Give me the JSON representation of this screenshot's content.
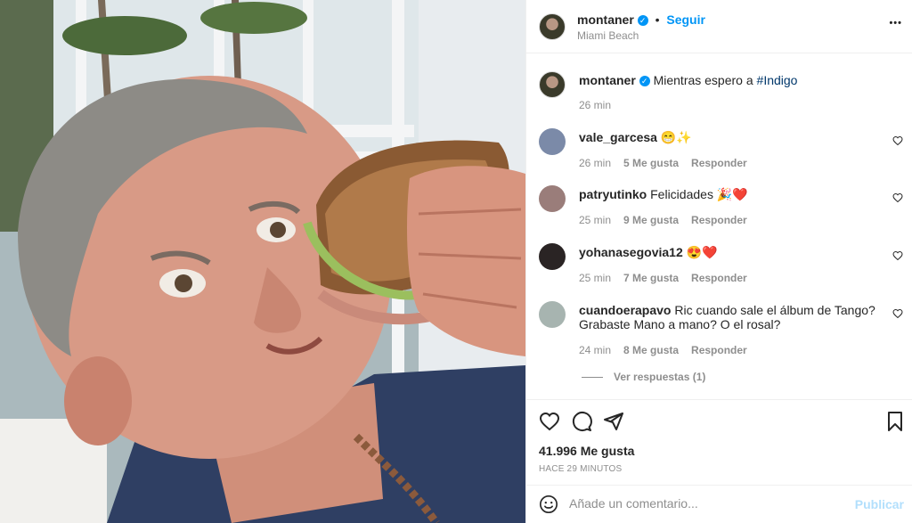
{
  "post": {
    "username": "montaner",
    "verified_icon": "✓",
    "separator": "•",
    "follow_label": "Seguir",
    "location": "Miami Beach",
    "more_icon": "•••"
  },
  "caption": {
    "username": "montaner",
    "text_prefix": "Mientras espero a ",
    "hashtag": "#Indigo",
    "time": "26 min"
  },
  "comments": [
    {
      "username": "vale_garcesa",
      "text": "😁✨",
      "time": "26 min",
      "likes": "5 Me gusta",
      "reply": "Responder",
      "avatar_color": "#7b8aa8"
    },
    {
      "username": "patryutinko",
      "text": "Felicidades 🎉❤️",
      "time": "25 min",
      "likes": "9 Me gusta",
      "reply": "Responder",
      "avatar_color": "#9a7d7a"
    },
    {
      "username": "yohanasegovia12",
      "text": "😍❤️",
      "time": "25 min",
      "likes": "7 Me gusta",
      "reply": "Responder",
      "avatar_color": "#2a2424"
    },
    {
      "username": "cuandoerapavo",
      "text": "Ric cuando sale el álbum de Tango? Grabaste Mano a mano? O el rosal?",
      "time": "24 min",
      "likes": "8 Me gusta",
      "reply": "Responder",
      "avatar_color": "#a7b4b0"
    }
  ],
  "view_replies": "Ver respuestas (1)",
  "likes_count": "41.996 Me gusta",
  "posted_ago": "HACE 29 MINUTOS",
  "add_comment": {
    "placeholder": "Añade un comentario...",
    "publish_label": "Publicar"
  },
  "colors": {
    "accent": "#0095f6",
    "publish_disabled": "#b2dffc"
  }
}
